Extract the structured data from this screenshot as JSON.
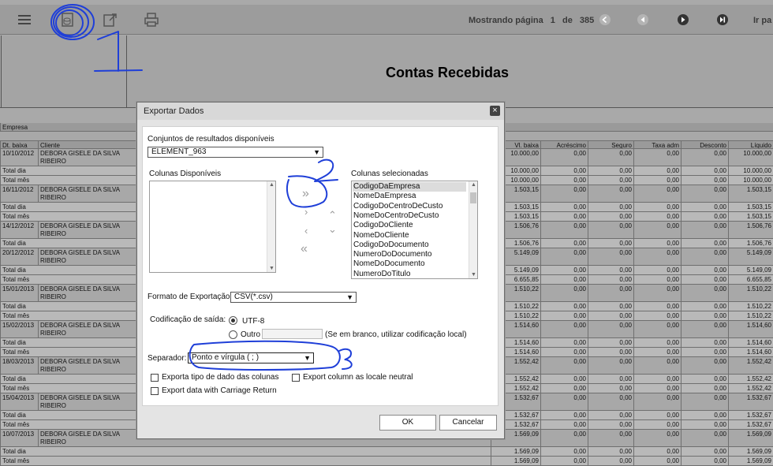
{
  "toolbar": {
    "icons": [
      "menu-icon",
      "export-data-icon",
      "export-icon",
      "print-icon"
    ],
    "paging_label": "Mostrando página",
    "page_current": "1",
    "page_sep": "de",
    "page_total": "385",
    "goto_label": "Ir pa"
  },
  "report": {
    "title": "Contas Recebidas",
    "group_label": "Empresa",
    "columns_left": [
      "Dt. baixa",
      "Cliente"
    ],
    "columns_right": [
      "Vl. baixa",
      "Acréscimo",
      "Seguro",
      "Taxa adm",
      "Desconto",
      "Líquido"
    ],
    "total_day": "Total dia",
    "total_month": "Total mês",
    "client_name": "DEBORA GISELE DA SILVA RIBEIRO",
    "rows": [
      {
        "type": "data",
        "date": "10/10/2012",
        "vl": "10.000,00",
        "liq": "10.000,00"
      },
      {
        "type": "day",
        "vl": "10.000,00",
        "liq": "10.000,00"
      },
      {
        "type": "month",
        "vl": "10.000,00",
        "liq": "10.000,00"
      },
      {
        "type": "data",
        "date": "16/11/2012",
        "vl": "1.503,15",
        "liq": "1.503,15"
      },
      {
        "type": "day",
        "vl": "1.503,15",
        "liq": "1.503,15"
      },
      {
        "type": "month",
        "vl": "1.503,15",
        "liq": "1.503,15"
      },
      {
        "type": "data",
        "date": "14/12/2012",
        "vl": "1.506,76",
        "liq": "1.506,76"
      },
      {
        "type": "day",
        "vl": "1.506,76",
        "liq": "1.506,76"
      },
      {
        "type": "data",
        "date": "20/12/2012",
        "vl": "5.149,09",
        "liq": "5.149,09"
      },
      {
        "type": "day",
        "vl": "5.149,09",
        "liq": "5.149,09"
      },
      {
        "type": "month",
        "vl": "6.655,85",
        "liq": "6.655,85"
      },
      {
        "type": "data",
        "date": "15/01/2013",
        "vl": "1.510,22",
        "liq": "1.510,22"
      },
      {
        "type": "day",
        "vl": "1.510,22",
        "liq": "1.510,22"
      },
      {
        "type": "month",
        "vl": "1.510,22",
        "liq": "1.510,22"
      },
      {
        "type": "data",
        "date": "15/02/2013",
        "vl": "1.514,60",
        "liq": "1.514,60"
      },
      {
        "type": "day",
        "vl": "1.514,60",
        "liq": "1.514,60"
      },
      {
        "type": "month",
        "vl": "1.514,60",
        "liq": "1.514,60"
      },
      {
        "type": "data",
        "date": "18/03/2013",
        "vl": "1.552,42",
        "liq": "1.552,42"
      },
      {
        "type": "day",
        "vl": "1.552,42",
        "liq": "1.552,42"
      },
      {
        "type": "month",
        "vl": "1.552,42",
        "liq": "1.552,42"
      },
      {
        "type": "data",
        "date": "15/04/2013",
        "vl": "1.532,67",
        "liq": "1.532,67"
      },
      {
        "type": "day",
        "vl": "1.532,67",
        "liq": "1.532,67"
      },
      {
        "type": "month",
        "vl": "1.532,67",
        "liq": "1.532,67"
      },
      {
        "type": "data",
        "date": "10/07/2013",
        "vl": "1.569,09",
        "liq": "1.569,09"
      },
      {
        "type": "day",
        "vl": "1.569,09",
        "liq": "1.569,09"
      },
      {
        "type": "month",
        "vl": "1.569,09",
        "liq": "1.569,09"
      }
    ],
    "zero": "0,00"
  },
  "dialog": {
    "title": "Exportar Dados",
    "close": "×",
    "result_sets_label": "Conjuntos de resultados disponíveis",
    "result_set_value": "ELEMENT_963",
    "available_cols_label": "Colunas Disponíveis",
    "selected_cols_label": "Colunas selecionadas",
    "selected_cols": [
      "CodigoDaEmpresa",
      "NomeDaEmpresa",
      "CodigoDoCentroDeCusto",
      "NomeDoCentroDeCusto",
      "CodigoDoCliente",
      "NomeDoCliente",
      "CodigoDoDocumento",
      "NumeroDoDocumento",
      "NomeDoDocumento",
      "NumeroDoTitulo"
    ],
    "move_all_right": "»",
    "move_right": "›",
    "move_left": "‹",
    "move_all_left": "«",
    "move_up": "⌃",
    "move_down": "⌄",
    "format_label": "Formato de Exportação:",
    "format_value": "CSV(*.csv)",
    "encoding_label": "Codificação de saída:",
    "encoding_utf8": "UTF-8",
    "encoding_other": "Outro",
    "encoding_hint": "(Se em branco, utilizar codificação local)",
    "separator_label": "Separador:",
    "separator_value": "Ponto e vírgula ( ; )",
    "chk_export_type": "Exporta tipo de dado das colunas",
    "chk_locale": "Export column as locale neutral",
    "chk_carriage": "Export data with Carriage Return",
    "ok": "OK",
    "cancel": "Cancelar"
  },
  "annotations": {
    "color": "#1f3fd8",
    "labels": [
      "1",
      "2",
      "3"
    ]
  }
}
